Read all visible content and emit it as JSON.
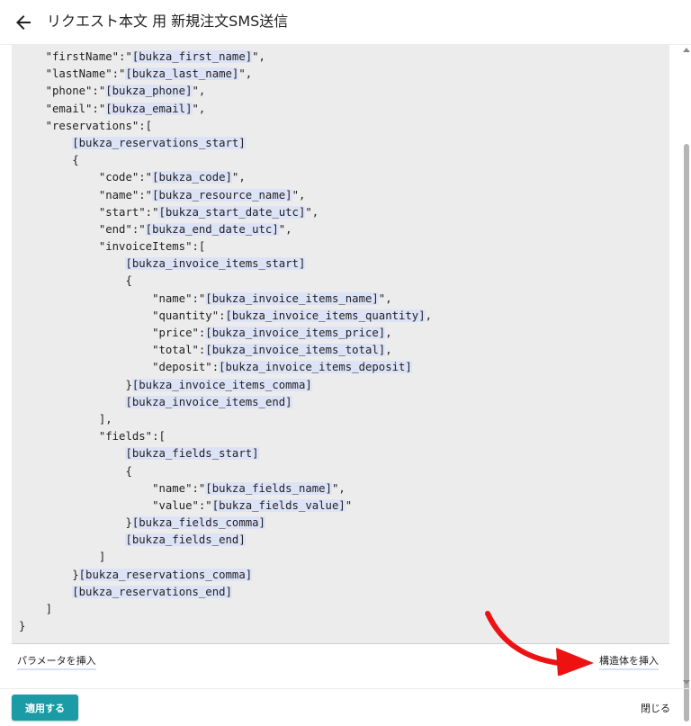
{
  "header": {
    "back_icon": "arrow-left-icon",
    "title": "リクエスト本文 用 新規注文SMS送信"
  },
  "editor": {
    "lines": [
      [
        {
          "t": "    \"firstName\":\"",
          "p": false
        },
        {
          "t": "[bukza_first_name]",
          "p": true
        },
        {
          "t": "\",",
          "p": false
        }
      ],
      [
        {
          "t": "    \"lastName\":\"",
          "p": false
        },
        {
          "t": "[bukza_last_name]",
          "p": true
        },
        {
          "t": "\",",
          "p": false
        }
      ],
      [
        {
          "t": "    \"phone\":\"",
          "p": false
        },
        {
          "t": "[bukza_phone]",
          "p": true
        },
        {
          "t": "\",",
          "p": false
        }
      ],
      [
        {
          "t": "    \"email\":\"",
          "p": false
        },
        {
          "t": "[bukza_email]",
          "p": true
        },
        {
          "t": "\",",
          "p": false
        }
      ],
      [
        {
          "t": "    \"reservations\":[",
          "p": false
        }
      ],
      [
        {
          "t": "        ",
          "p": false
        },
        {
          "t": "[bukza_reservations_start]",
          "p": true
        }
      ],
      [
        {
          "t": "        {",
          "p": false
        }
      ],
      [
        {
          "t": "            \"code\":\"",
          "p": false
        },
        {
          "t": "[bukza_code]",
          "p": true
        },
        {
          "t": "\",",
          "p": false
        }
      ],
      [
        {
          "t": "            \"name\":\"",
          "p": false
        },
        {
          "t": "[bukza_resource_name]",
          "p": true
        },
        {
          "t": "\",",
          "p": false
        }
      ],
      [
        {
          "t": "            \"start\":\"",
          "p": false
        },
        {
          "t": "[bukza_start_date_utc]",
          "p": true
        },
        {
          "t": "\",",
          "p": false
        }
      ],
      [
        {
          "t": "            \"end\":\"",
          "p": false
        },
        {
          "t": "[bukza_end_date_utc]",
          "p": true
        },
        {
          "t": "\",",
          "p": false
        }
      ],
      [
        {
          "t": "            \"invoiceItems\":[",
          "p": false
        }
      ],
      [
        {
          "t": "                ",
          "p": false
        },
        {
          "t": "[bukza_invoice_items_start]",
          "p": true
        }
      ],
      [
        {
          "t": "                {",
          "p": false
        }
      ],
      [
        {
          "t": "                    \"name\":\"",
          "p": false
        },
        {
          "t": "[bukza_invoice_items_name]",
          "p": true
        },
        {
          "t": "\",",
          "p": false
        }
      ],
      [
        {
          "t": "                    \"quantity\":",
          "p": false
        },
        {
          "t": "[bukza_invoice_items_quantity]",
          "p": true
        },
        {
          "t": ",",
          "p": false
        }
      ],
      [
        {
          "t": "                    \"price\":",
          "p": false
        },
        {
          "t": "[bukza_invoice_items_price]",
          "p": true
        },
        {
          "t": ",",
          "p": false
        }
      ],
      [
        {
          "t": "                    \"total\":",
          "p": false
        },
        {
          "t": "[bukza_invoice_items_total]",
          "p": true
        },
        {
          "t": ",",
          "p": false
        }
      ],
      [
        {
          "t": "                    \"deposit\":",
          "p": false
        },
        {
          "t": "[bukza_invoice_items_deposit]",
          "p": true
        }
      ],
      [
        {
          "t": "                }",
          "p": false
        },
        {
          "t": "[bukza_invoice_items_comma]",
          "p": true
        }
      ],
      [
        {
          "t": "                ",
          "p": false
        },
        {
          "t": "[bukza_invoice_items_end]",
          "p": true
        }
      ],
      [
        {
          "t": "            ],",
          "p": false
        }
      ],
      [
        {
          "t": "            \"fields\":[",
          "p": false
        }
      ],
      [
        {
          "t": "                ",
          "p": false
        },
        {
          "t": "[bukza_fields_start]",
          "p": true
        }
      ],
      [
        {
          "t": "                {",
          "p": false
        }
      ],
      [
        {
          "t": "                    \"name\":\"",
          "p": false
        },
        {
          "t": "[bukza_fields_name]",
          "p": true
        },
        {
          "t": "\",",
          "p": false
        }
      ],
      [
        {
          "t": "                    \"value\":\"",
          "p": false
        },
        {
          "t": "[bukza_fields_value]",
          "p": true
        },
        {
          "t": "\"",
          "p": false
        }
      ],
      [
        {
          "t": "                }",
          "p": false
        },
        {
          "t": "[bukza_fields_comma]",
          "p": true
        }
      ],
      [
        {
          "t": "                ",
          "p": false
        },
        {
          "t": "[bukza_fields_end]",
          "p": true
        }
      ],
      [
        {
          "t": "            ]",
          "p": false
        }
      ],
      [
        {
          "t": "        }",
          "p": false
        },
        {
          "t": "[bukza_reservations_comma]",
          "p": true
        }
      ],
      [
        {
          "t": "        ",
          "p": false
        },
        {
          "t": "[bukza_reservations_end]",
          "p": true
        }
      ],
      [
        {
          "t": "    ]",
          "p": false
        }
      ],
      [
        {
          "t": "}",
          "p": false
        }
      ]
    ]
  },
  "actions": {
    "insert_param_label": "パラメータを挿入",
    "insert_struct_label": "構造体を挿入"
  },
  "footer": {
    "apply_label": "適用する",
    "close_label": "閉じる"
  },
  "colors": {
    "apply_button": "#1a9ba6",
    "editor_bg": "#ececec",
    "param_highlight": "#dde3f7",
    "annotation_arrow": "#ee1111"
  }
}
